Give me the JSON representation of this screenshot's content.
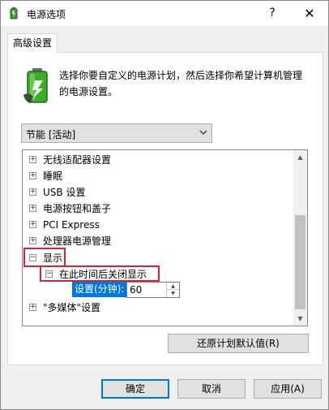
{
  "window": {
    "title": "电源选项",
    "help_label": "?",
    "close_label": "✕"
  },
  "tab": {
    "label": "高级设置"
  },
  "description": "选择你要自定义的电源计划，然后选择你希望计算机管理的电源设置。",
  "plan_select": {
    "value": "节能 [活动]"
  },
  "tree": {
    "items": [
      {
        "expander": "+",
        "label": "无线适配器设置"
      },
      {
        "expander": "+",
        "label": "睡眠"
      },
      {
        "expander": "+",
        "label": "USB 设置"
      },
      {
        "expander": "+",
        "label": "电源按钮和盖子"
      },
      {
        "expander": "+",
        "label": "PCI Express"
      },
      {
        "expander": "+",
        "label": "处理器电源管理"
      },
      {
        "expander": "−",
        "label": "显示"
      },
      {
        "expander": "−",
        "label": "在此时间后关闭显示"
      },
      {
        "expander": "+",
        "label": "\"多媒体\"设置"
      }
    ],
    "setting_label": "设置(分钟):",
    "setting_value": "60"
  },
  "buttons": {
    "restore": "还原计划默认值(R)",
    "ok": "确定",
    "cancel": "取消",
    "apply": "应用(A)"
  },
  "colors": {
    "accent": "#0078d7",
    "highlight_box": "#e0202a"
  }
}
